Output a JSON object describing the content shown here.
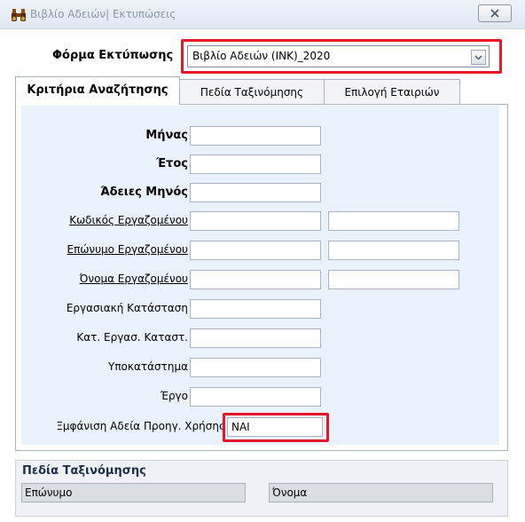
{
  "window": {
    "title": "Βιβλίο Αδειών| Εκτυπώσεις",
    "icon": "binoculars-icon",
    "close_icon": "close-icon"
  },
  "form": {
    "label": "Φόρμα Εκτύπωσης",
    "selected": "Βιβλίο Αδειών (ΙΝΚ)_2020",
    "highlight_color": "#e8162a"
  },
  "tabs": [
    {
      "label": "Κριτήρια Αναζήτησης",
      "active": true
    },
    {
      "label": "Πεδία Ταξινόμησης",
      "active": false
    },
    {
      "label": "Επιλογή Εταιριών",
      "active": false
    }
  ],
  "criteria": {
    "month": {
      "label": "Μήνας",
      "value": ""
    },
    "year": {
      "label": "Έτος",
      "value": ""
    },
    "leaves_month": {
      "label": "Άδειες Μηνός",
      "value": ""
    },
    "employee_code": {
      "label": "Κωδικός Εργαζομένου",
      "from": "",
      "to": ""
    },
    "employee_surname": {
      "label": "Επώνυμο Εργαζομένου",
      "from": "",
      "to": ""
    },
    "employee_name": {
      "label": "Όνομα Εργαζομένου",
      "from": "",
      "to": ""
    },
    "work_status": {
      "label": "Εργασιακή Κατάσταση",
      "value": ""
    },
    "work_status_cat": {
      "label": "Κατ. Εργασ. Καταστ.",
      "value": ""
    },
    "branch": {
      "label": "Υποκατάστημα",
      "value": ""
    },
    "project": {
      "label": "Έργο",
      "value": ""
    },
    "show_prev_leave": {
      "label": "Ξμφάνιση Αδεία Προηγ. Χρήσης",
      "value": "ΝΑΙ"
    }
  },
  "sorting": {
    "title": "Πεδία Ταξινόμησης",
    "field1": "Επώνυμο",
    "field2": "Όνομα"
  },
  "colors": {
    "panel_bg": "#e9f1fb",
    "titlebar_text": "#8a96a6"
  }
}
